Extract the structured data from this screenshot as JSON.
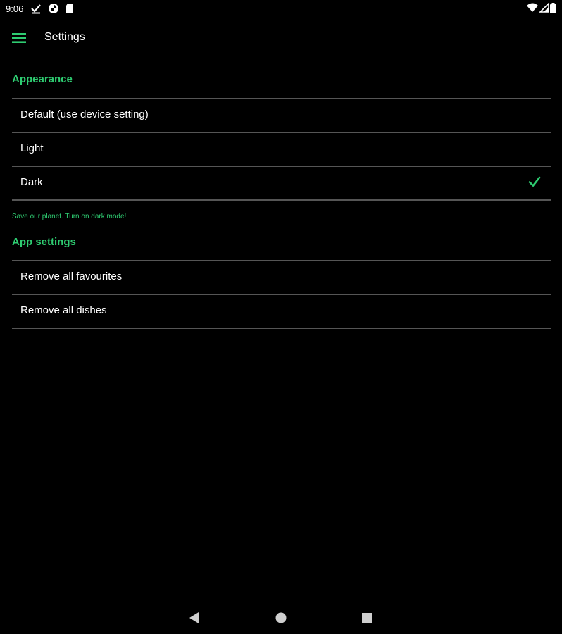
{
  "status_bar": {
    "time": "9:06",
    "left_icons": [
      "download-done-icon",
      "pinwheel-app-icon",
      "sd-card-icon"
    ],
    "right_icons": [
      "wifi-icon",
      "signal-icon",
      "battery-icon"
    ]
  },
  "app_bar": {
    "title": "Settings",
    "menu_icon": "hamburger-menu-icon"
  },
  "appearance": {
    "header": "Appearance",
    "options": [
      {
        "label": "Default (use device setting)",
        "selected": false
      },
      {
        "label": "Light",
        "selected": false
      },
      {
        "label": "Dark",
        "selected": true
      }
    ],
    "hint": "Save our planet. Turn on dark mode!"
  },
  "app_settings": {
    "header": "App settings",
    "items": [
      {
        "label": "Remove all favourites"
      },
      {
        "label": "Remove all dishes"
      }
    ]
  },
  "nav_bar": {
    "buttons": [
      "back-icon",
      "home-icon",
      "recents-icon"
    ]
  },
  "colors": {
    "background": "#000000",
    "accent": "#2ecc71",
    "divider": "#555555",
    "text": "#ffffff"
  }
}
